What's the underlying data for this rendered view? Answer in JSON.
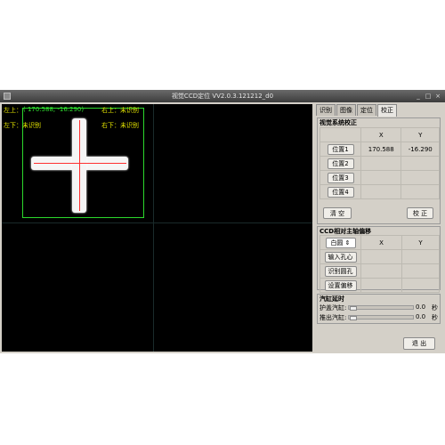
{
  "window": {
    "title": "视觉CCD定位 VV2.0.3.121212_d0"
  },
  "overlay": {
    "top_left_label": "左上：",
    "top_left_coords": "( 170.588,  -16.290)",
    "top_right": "右上：未识别",
    "bottom_left": "左下：未识别",
    "bottom_right": "右下：未识别"
  },
  "tabs": [
    "识别",
    "图像",
    "定位",
    "校正"
  ],
  "calib": {
    "title": "视觉系统校正",
    "col_x": "X",
    "col_y": "Y",
    "rows": [
      {
        "label": "位置1",
        "x": "170.588",
        "y": "-16.290"
      },
      {
        "label": "位置2",
        "x": "",
        "y": ""
      },
      {
        "label": "位置3",
        "x": "",
        "y": ""
      },
      {
        "label": "位置4",
        "x": "",
        "y": ""
      }
    ],
    "clear_label": "清 空",
    "calibrate_label": "校 正"
  },
  "offset": {
    "title": "CCD相对主轴偏移",
    "select_value": "白圆",
    "col_x": "X",
    "col_y": "Y",
    "buttons": [
      "输入孔心",
      "识别圆孔",
      "设置偏移"
    ]
  },
  "cylinder": {
    "title": "汽缸延时",
    "protect_label": "护盖汽缸:",
    "protect_value": "0.0",
    "eject_label": "推出汽缸:",
    "eject_value": "0.0",
    "unit": "秒"
  },
  "exit_label": "退 出"
}
